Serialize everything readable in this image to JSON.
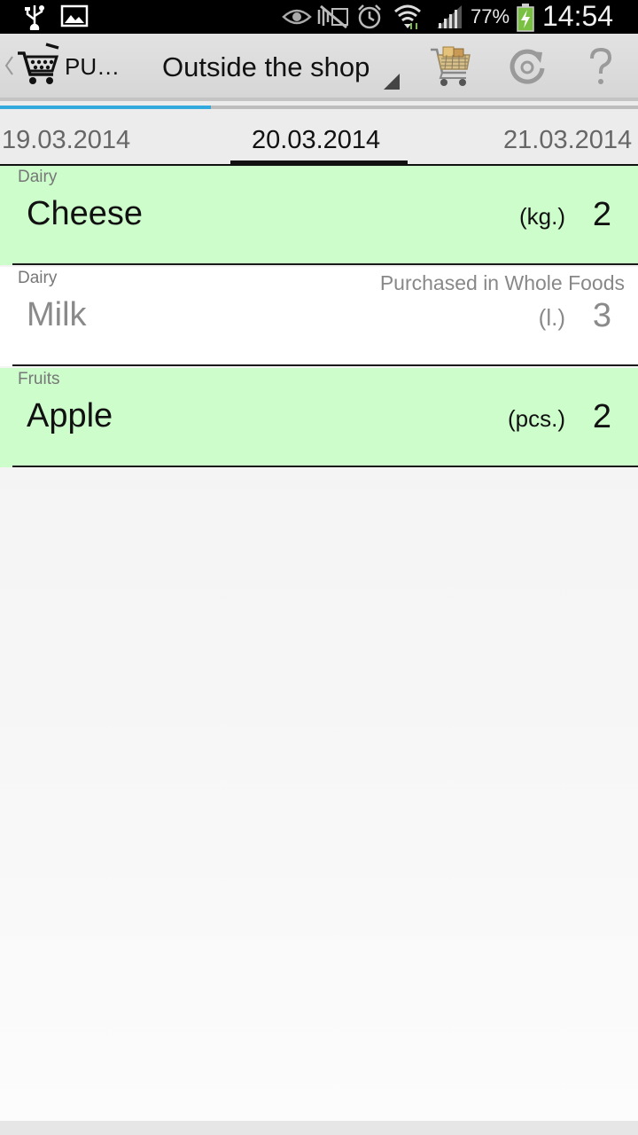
{
  "status_bar": {
    "battery_percent": "77%",
    "time": "14:54",
    "icons": [
      "usb-icon",
      "image-icon",
      "eye-icon",
      "no-sound-icon",
      "alarm-icon",
      "wifi-icon",
      "signal-icon",
      "battery-charging-icon"
    ]
  },
  "action_bar": {
    "app_title": "PU…",
    "spinner_value": "Outside the shop",
    "actions": [
      "cart-icon",
      "refresh-icon",
      "help-icon"
    ]
  },
  "date_pager": {
    "prev_date": "19.03.2014",
    "current_date": "20.03.2014",
    "next_date": "21.03.2014",
    "progress": 0.33
  },
  "items": [
    {
      "category": "Dairy",
      "name": "Cheese",
      "unit": "(kg.)",
      "quantity": "2",
      "note": "",
      "purchased": false
    },
    {
      "category": "Dairy",
      "name": "Milk",
      "unit": "(l.)",
      "quantity": "3",
      "note": "Purchased in Whole Foods",
      "purchased": true
    },
    {
      "category": "Fruits",
      "name": "Apple",
      "unit": "(pcs.)",
      "quantity": "2",
      "note": "",
      "purchased": false
    }
  ],
  "colors": {
    "pending_row": "#ccfdcb",
    "purchased_row": "#ffffff",
    "accent": "#34a9dd"
  }
}
